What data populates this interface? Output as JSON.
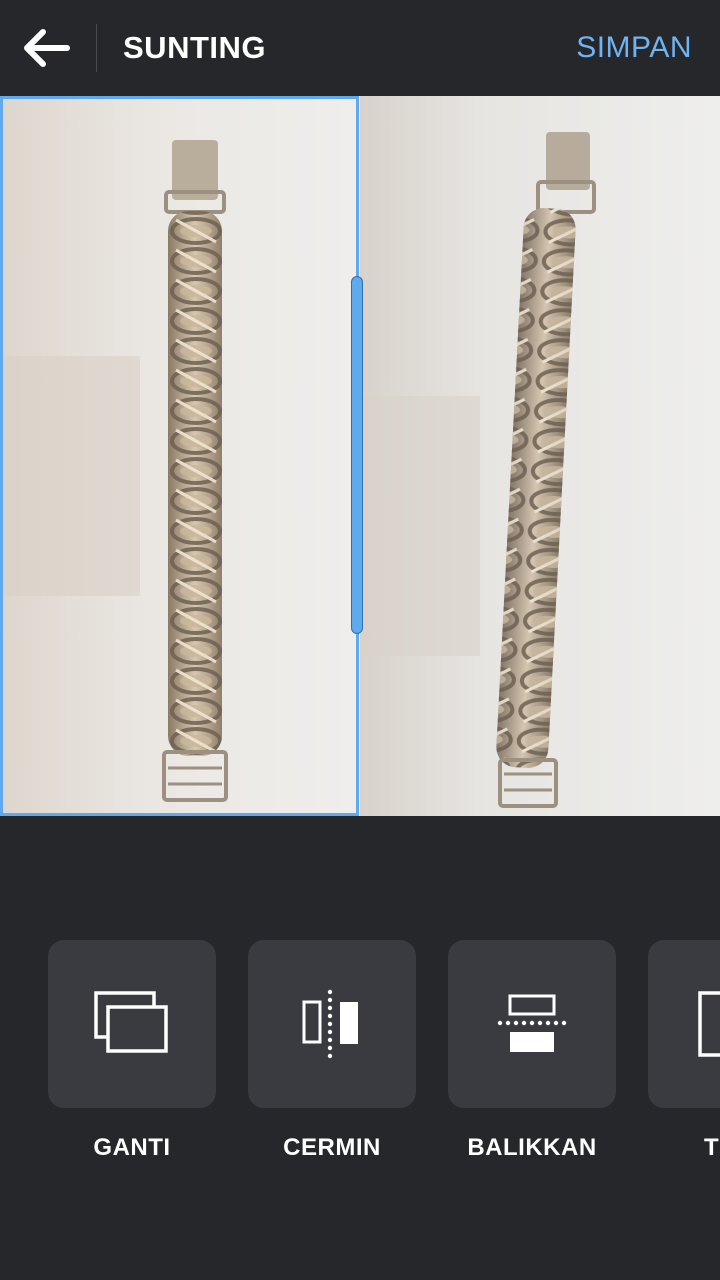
{
  "header": {
    "back_icon": "arrow-left-icon",
    "title": "SUNTING",
    "save_label": "SIMPAN",
    "accent_color": "#6fb3f0"
  },
  "canvas": {
    "layout": "two-panel vertical split",
    "selected_panel": "left",
    "photos": [
      {
        "subject": "chain bracelet photo (left)"
      },
      {
        "subject": "chain bracelet photo (right)"
      }
    ]
  },
  "tools": [
    {
      "label": "GANTI",
      "icon": "replace-icon"
    },
    {
      "label": "CERMIN",
      "icon": "mirror-icon"
    },
    {
      "label": "BALIKKAN",
      "icon": "flip-icon"
    },
    {
      "label": "T",
      "icon": "rotate-icon"
    }
  ]
}
